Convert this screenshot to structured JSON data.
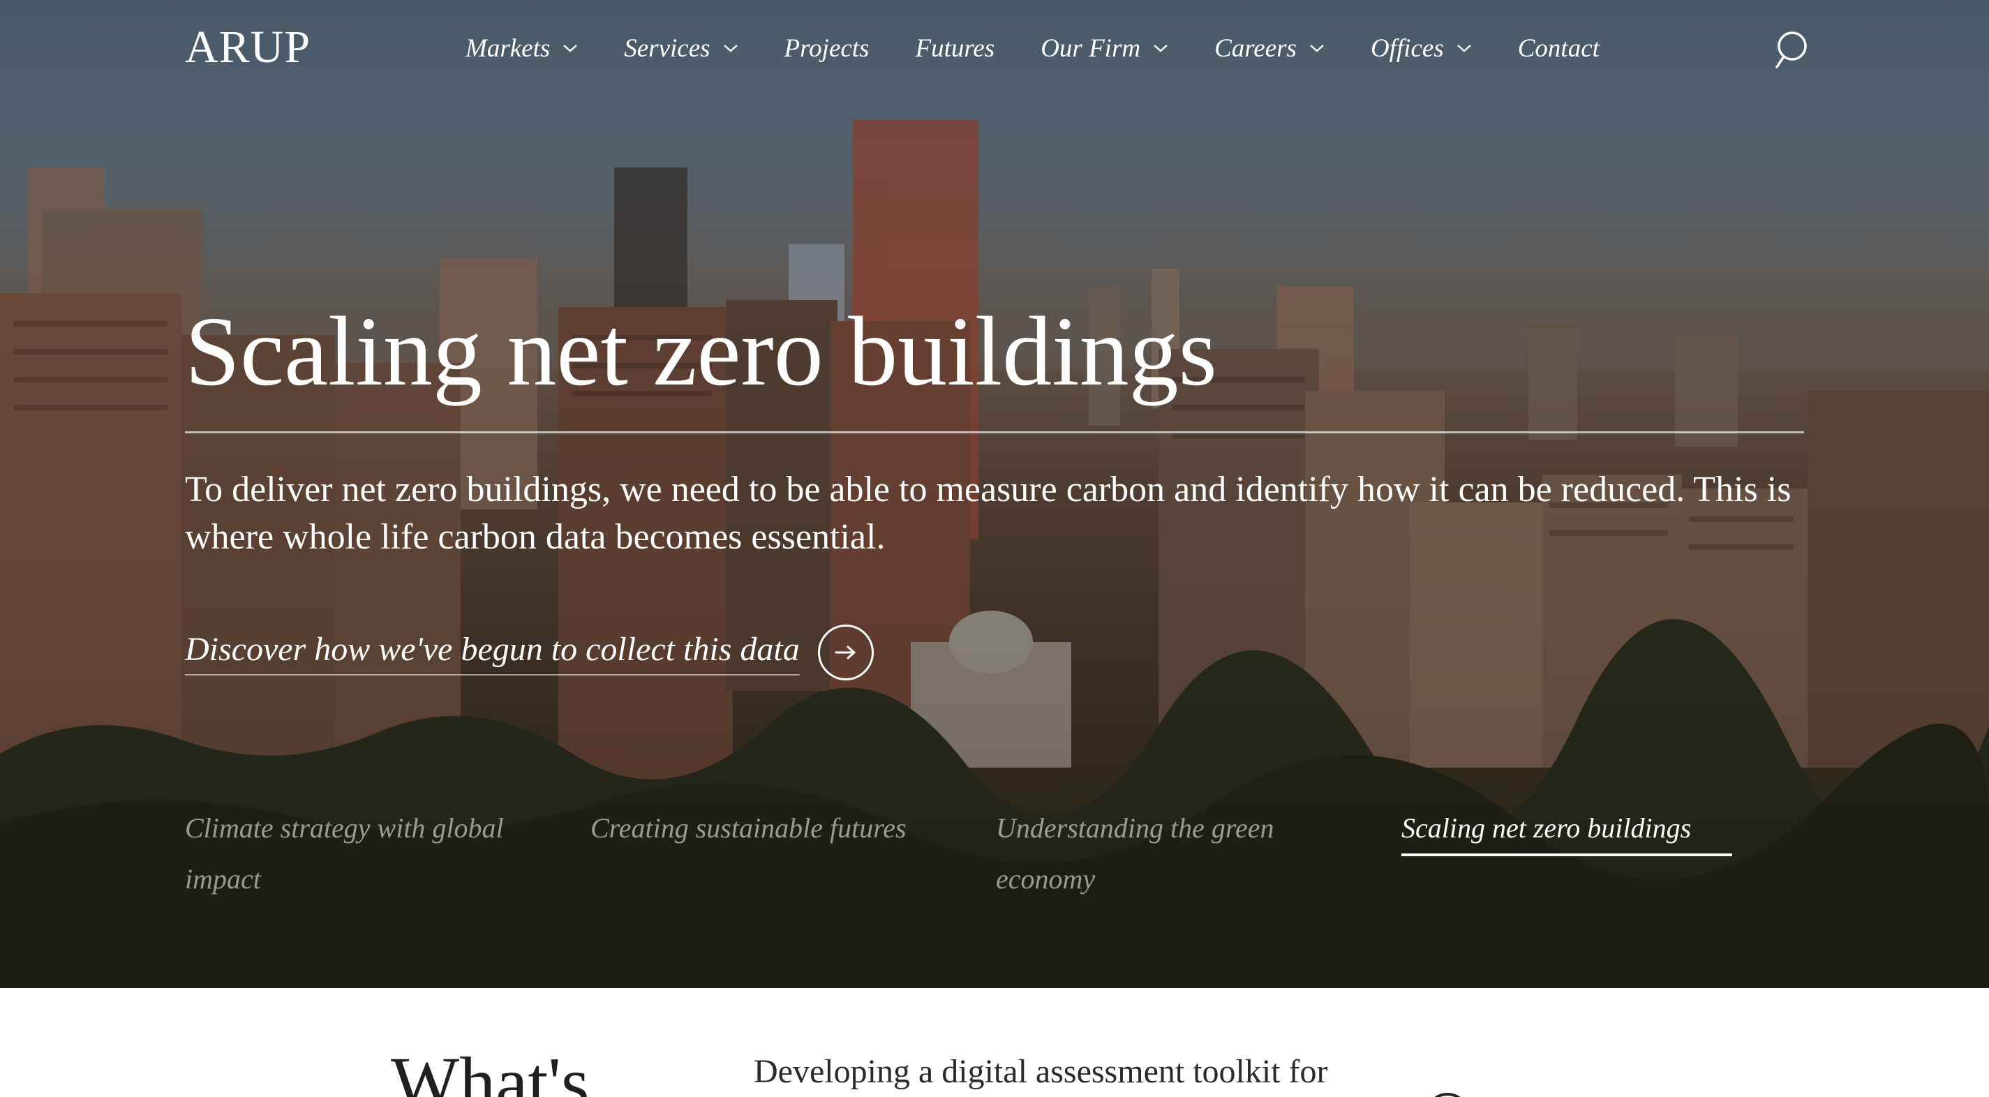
{
  "header": {
    "logo": "ARUP",
    "nav": [
      {
        "label": "Markets",
        "has_dropdown": true
      },
      {
        "label": "Services",
        "has_dropdown": true
      },
      {
        "label": "Projects",
        "has_dropdown": false
      },
      {
        "label": "Futures",
        "has_dropdown": false
      },
      {
        "label": "Our Firm",
        "has_dropdown": true
      },
      {
        "label": "Careers",
        "has_dropdown": true
      },
      {
        "label": "Offices",
        "has_dropdown": true
      },
      {
        "label": "Contact",
        "has_dropdown": false
      }
    ],
    "search_icon": "search-icon"
  },
  "hero": {
    "title": "Scaling net zero buildings",
    "description": "To deliver net zero buildings, we need to be able to measure carbon and identify how it can be reduced. This is where whole life carbon data becomes essential.",
    "cta_label": "Discover how we've begun to collect this data",
    "cta_icon": "arrow-right-icon"
  },
  "tabs": [
    {
      "label": "Climate strategy with global impact",
      "active": false
    },
    {
      "label": "Creating sustainable futures",
      "active": false
    },
    {
      "label": "Understanding the green economy",
      "active": false
    },
    {
      "label": "Scaling net zero buildings",
      "active": true
    }
  ],
  "below": {
    "heading": "What's",
    "teaser": "Developing a digital assessment toolkit for"
  },
  "colors": {
    "text_on_hero": "#ffffff",
    "tab_inactive": "rgba(255,255,255,0.55)",
    "page_bg": "#ffffff",
    "body_text": "#1f1f1f"
  }
}
